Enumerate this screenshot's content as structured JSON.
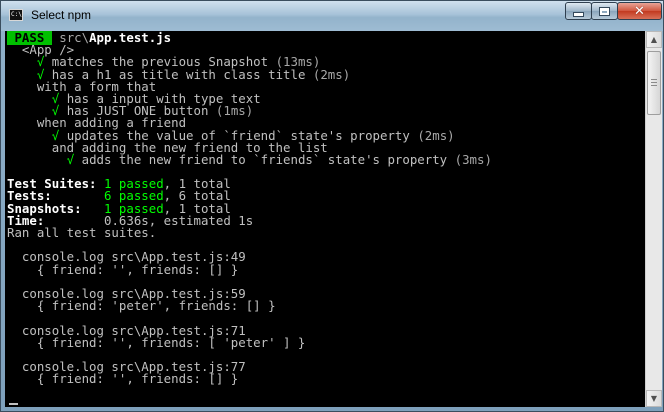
{
  "window": {
    "title": "Select npm",
    "icon": "cmd-console-icon",
    "icon_text": "C:\\"
  },
  "controls": {
    "minimize": "minimize-icon",
    "maximize": "maximize-icon",
    "close": "close-icon",
    "close_glyph": "✕"
  },
  "console": {
    "header": {
      "badge": " PASS ",
      "space": " ",
      "path_dir": "src\\",
      "path_file": "App.test.js"
    },
    "tree": [
      "  <App />",
      "    √ matches the previous Snapshot (13ms)",
      "    √ has a h1 as title with class title (2ms)",
      "    with a form that",
      "      √ has a input with type text",
      "      √ has JUST ONE button (1ms)",
      "    when adding a friend",
      "      √ updates the value of `friend` state's property (2ms)",
      "      and adding the new friend to the list",
      "        √ adds the new friend to `friends` state's property (3ms)"
    ],
    "summary": {
      "suites_label": "Test Suites: ",
      "suites_passed": "1 passed",
      "suites_total": ", 1 total",
      "tests_label": "Tests:       ",
      "tests_passed": "6 passed",
      "tests_total": ", 6 total",
      "snap_label": "Snapshots:   ",
      "snap_passed": "1 passed",
      "snap_total": ", 1 total",
      "time_label": "Time:        ",
      "time_value": "0.636s, estimated 1s",
      "ran": "Ran all test suites."
    },
    "logs": [
      {
        "src": "  console.log src\\App.test.js:49",
        "value": "    { friend: '', friends: [] }"
      },
      {
        "src": "  console.log src\\App.test.js:59",
        "value": "    { friend: 'peter', friends: [] }"
      },
      {
        "src": "  console.log src\\App.test.js:71",
        "value": "    { friend: '', friends: [ 'peter' ] }"
      },
      {
        "src": "  console.log src\\App.test.js:77",
        "value": "    { friend: '', friends: [] }"
      }
    ]
  },
  "scrollbar": {
    "up": "▲",
    "down": "▼"
  },
  "colors": {
    "console_bg": "#000000",
    "text": "#c0c0c0",
    "pass": "#00ff00",
    "badge_bg": "#00c000"
  }
}
